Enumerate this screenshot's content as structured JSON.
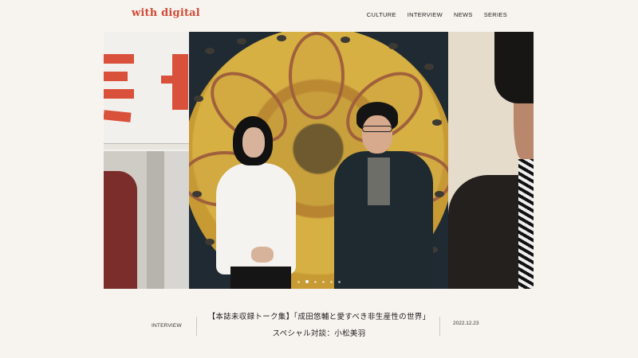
{
  "header": {
    "logo": "with digital",
    "nav": [
      "CULTURE",
      "INTERVIEW",
      "NEWS",
      "SERIES"
    ]
  },
  "carousel": {
    "slide_count": 6,
    "active_index": 1
  },
  "featured": {
    "category": "INTERVIEW",
    "title": "【本誌未収録トーク集】「成田悠輔と愛すべき非生産性の世界」スペシャル対談：小松美羽",
    "date": "2022.12.23"
  },
  "colors": {
    "brand": "#d24a36",
    "background": "#f7f4ef"
  }
}
